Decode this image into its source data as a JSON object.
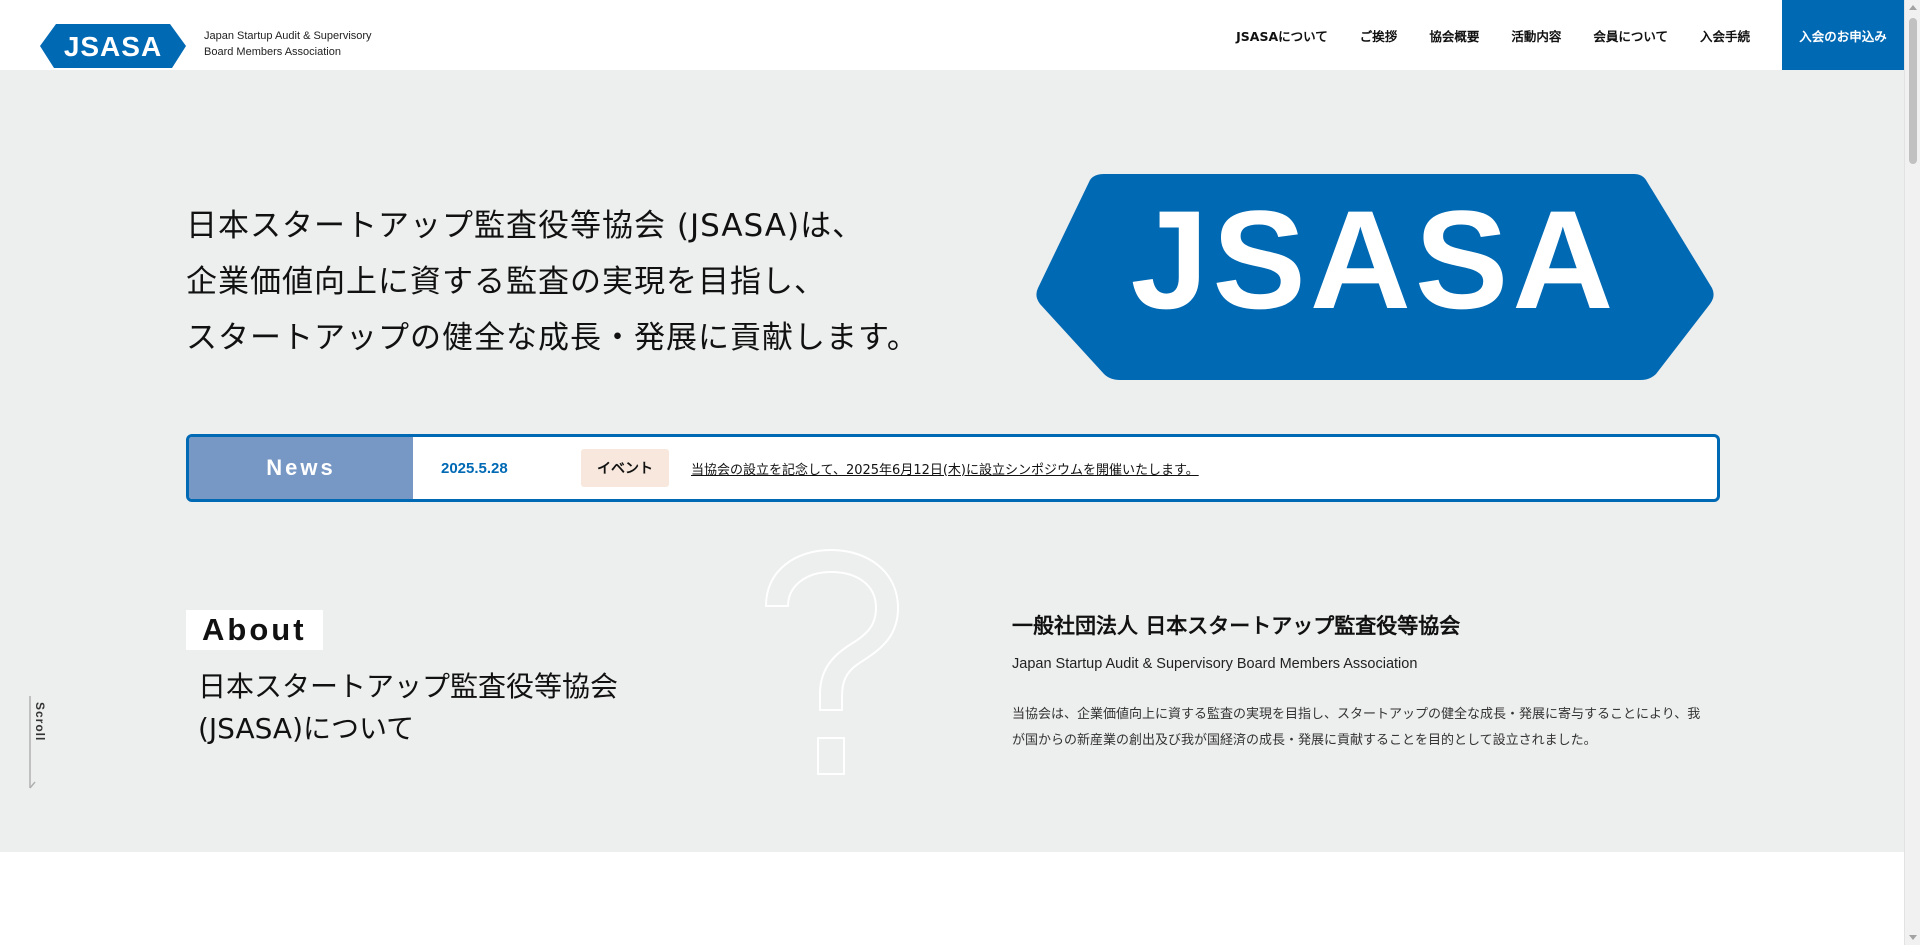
{
  "colors": {
    "brand_blue": "#0069b4",
    "news_label_bg": "#7797c4",
    "tag_bg": "#f7e7dc",
    "band_bg": "#edeeee"
  },
  "header": {
    "logo_text": "JSASA",
    "logo_subtitle_line1": "Japan Startup Audit & Supervisory",
    "logo_subtitle_line2": "Board Members Association",
    "nav": [
      {
        "label": "JSASAについて"
      },
      {
        "label": "ご挨拶"
      },
      {
        "label": "協会概要"
      },
      {
        "label": "活動内容"
      },
      {
        "label": "会員について"
      },
      {
        "label": "入会手続"
      }
    ],
    "cta_label": "入会のお申込み"
  },
  "hero": {
    "lines": [
      "日本スタートアップ監査役等協会 (JSASA)は、",
      "企業価値向上に資する監査の実現を目指し、",
      "スタートアップの健全な成長・発展に貢献します。"
    ],
    "logo_text": "JSASA"
  },
  "news": {
    "label": "News",
    "date": "2025.5.28",
    "tag": "イベント",
    "headline": "当協会の設立を記念して、2025年6月12日(木)に設立シンポジウムを開催いたします。"
  },
  "about": {
    "heading": "About",
    "subtitle_line1": "日本スタートアップ監査役等協会",
    "subtitle_line2": "(JSASA)について",
    "org_name": "一般社団法人 日本スタートアップ監査役等協会",
    "org_name_en": "Japan Startup Audit & Supervisory Board Members Association",
    "description": "当協会は、企業価値向上に資する監査の実現を目指し、スタートアップの健全な成長・発展に寄与することにより、我が国からの新産業の創出及び我が国経済の成長・発展に貢献することを目的として設立されました。"
  },
  "scroll_indicator": {
    "label": "Scroll"
  }
}
